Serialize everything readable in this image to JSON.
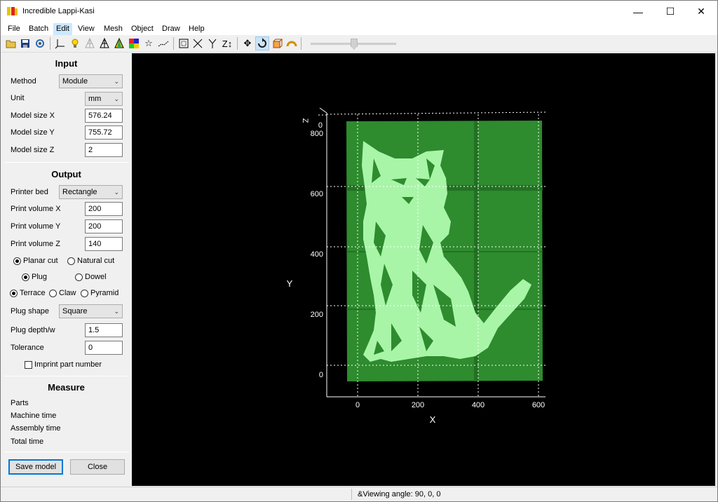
{
  "window": {
    "title": "Incredible Lappi-Kasi"
  },
  "menu": [
    "File",
    "Batch",
    "Edit",
    "View",
    "Mesh",
    "Object",
    "Draw",
    "Help"
  ],
  "toolbar": {
    "icons": [
      "open-folder-icon",
      "save-icon",
      "settings-icon",
      "axis-icon",
      "light-bulb-icon",
      "wireframe-icon",
      "mesh-icon",
      "color-mesh-icon",
      "rainbow-icon",
      "star-icon",
      "dots-icon",
      "bounding-box-icon",
      "rotate-x-icon",
      "rotate-y-icon",
      "rotate-z-icon",
      "move-icon",
      "rotate-icon",
      "cube-rotate-icon",
      "arch-icon"
    ],
    "zoom_level": 0.5
  },
  "input": {
    "title": "Input",
    "method_label": "Method",
    "method_value": "Module",
    "unit_label": "Unit",
    "unit_value": "mm",
    "size_x_label": "Model size X",
    "size_x_value": "576.24",
    "size_y_label": "Model size Y",
    "size_y_value": "755.72",
    "size_z_label": "Model size Z",
    "size_z_value": "2"
  },
  "output": {
    "title": "Output",
    "bed_label": "Printer bed",
    "bed_value": "Rectangle",
    "vol_x_label": "Print volume X",
    "vol_x_value": "200",
    "vol_y_label": "Print volume Y",
    "vol_y_value": "200",
    "vol_z_label": "Print volume Z",
    "vol_z_value": "140",
    "cut_planar": "Planar cut",
    "cut_natural": "Natural cut",
    "joint_plug": "Plug",
    "joint_dowel": "Dowel",
    "style_terrace": "Terrace",
    "style_claw": "Claw",
    "style_pyramid": "Pyramid",
    "plug_shape_label": "Plug shape",
    "plug_shape_value": "Square",
    "plug_depth_label": "Plug depth/w",
    "plug_depth_value": "1.5",
    "tolerance_label": "Tolerance",
    "tolerance_value": "0",
    "imprint_label": "Imprint part number"
  },
  "measure": {
    "title": "Measure",
    "parts": "Parts",
    "machine_time": "Machine time",
    "assembly_time": "Assembly time",
    "total_time": "Total time"
  },
  "buttons": {
    "save": "Save model",
    "close": "Close"
  },
  "viewport": {
    "axis_x": "X",
    "axis_y": "Y",
    "axis_z": "Z",
    "x_ticks": [
      "0",
      "200",
      "400",
      "600"
    ],
    "y_ticks": [
      "800",
      "600",
      "400",
      "200",
      "0"
    ],
    "z_tick": "0",
    "colors": {
      "plate": "#2e8b2e",
      "image": "#a8f5a8",
      "grid": "#ffffff"
    }
  },
  "status": {
    "text": "&Viewing angle: 90, 0, 0"
  }
}
